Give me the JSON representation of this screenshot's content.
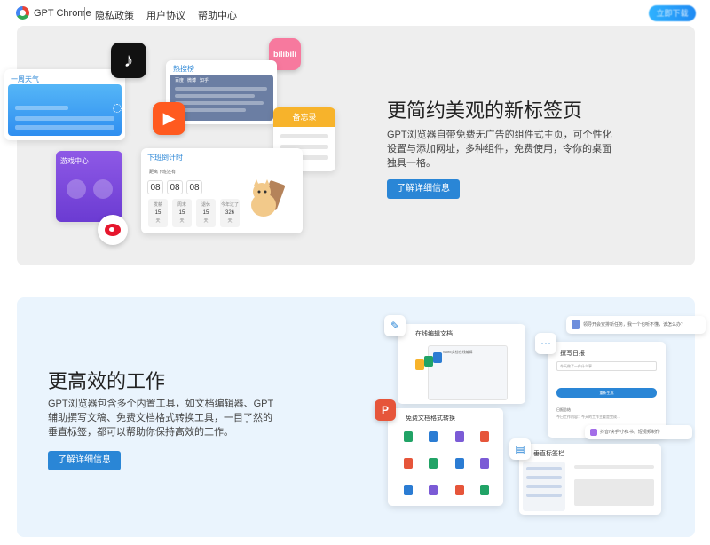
{
  "header": {
    "logo_text": "GPT Chrome",
    "nav": [
      "隐私政策",
      "用户协议",
      "帮助中心"
    ],
    "login_label": "立即下载"
  },
  "section1": {
    "title": "更简约美观的新标签页",
    "description": "GPT浏览器自带免费无广告的组件式主页，可个性化设置与添加网址，多种组件，免费使用，令你的桌面独具一格。",
    "button": "了解详细信息",
    "widgets": {
      "weather_label": "一周天气",
      "hotlist_label": "热搜榜",
      "hotlist_tabs": [
        "百度",
        "微博",
        "知乎"
      ],
      "memo_label": "备忘录",
      "game_label": "游戏中心",
      "countdown_label": "下班倒计时",
      "countdown_sub": "距离下班还有",
      "countdown_digits": [
        "08",
        "08",
        "08"
      ],
      "countdown_stats": [
        {
          "label": "发薪",
          "value": "15",
          "unit": "天"
        },
        {
          "label": "周末",
          "value": "15",
          "unit": "天"
        },
        {
          "label": "退休",
          "value": "15",
          "unit": "天"
        },
        {
          "label": "今年过了",
          "value": "326",
          "unit": "天"
        }
      ],
      "bilibili_text": "bilibili"
    }
  },
  "section2": {
    "title": "更高效的工作",
    "description": "GPT浏览器包含多个内置工具，如文档编辑器、GPT辅助撰写文稿、免费文档格式转换工具，一目了然的垂直标签，都可以帮助你保持高效的工作。",
    "button": "了解详细信息",
    "tools": {
      "doc_label": "在线编辑文档",
      "doc_file_name": "Word文档在线编辑",
      "assist_label": "撰写日报",
      "assist_placeholder": "今天做了一件什么事",
      "assist_button": "重新生成",
      "convert_label": "免费文档格式转换",
      "tabs_label": "垂直标签栏",
      "bubble1": "领导开会安排新任务，我一个也听不懂，该怎么办？",
      "bubble2": "抖音/快手/小红书，短视频制作",
      "report_title": "日报总结 ",
      "report_line": "今日工作内容：今天的工作主要是完成…"
    }
  },
  "colors": {
    "accent": "#2a86d6",
    "section1_bg": "#eeeeee",
    "section2_bg": "#eaf4fd"
  }
}
